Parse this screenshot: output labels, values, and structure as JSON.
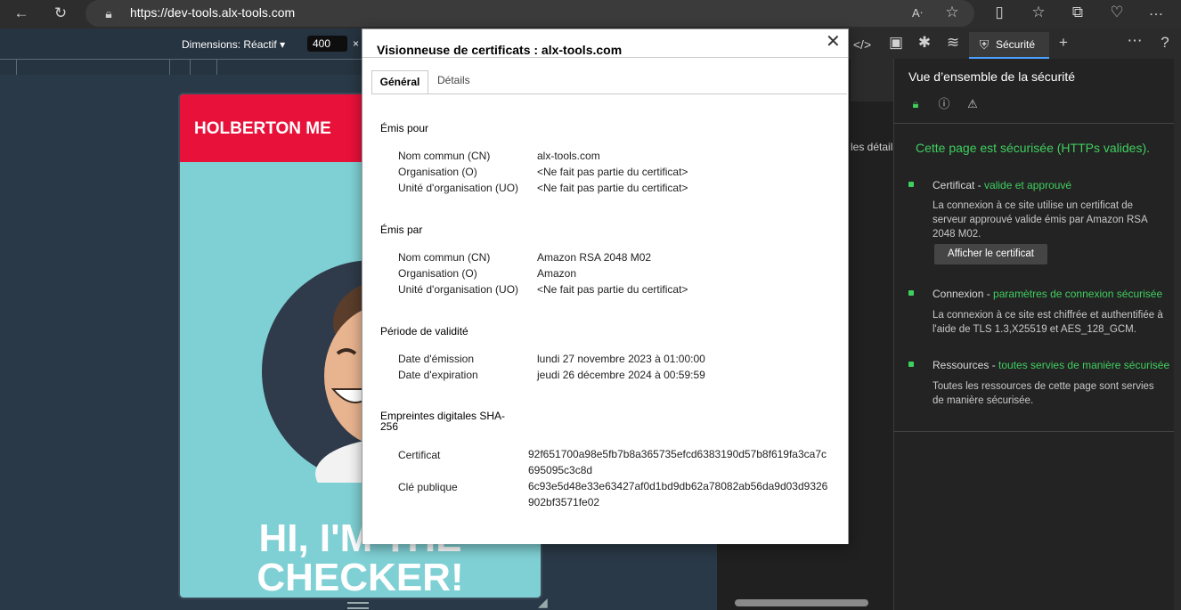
{
  "browser": {
    "url": "https://dev-tools.alx-tools.com"
  },
  "device_toolbar": {
    "dimensions_label": "Dimensions: Réactif",
    "width_value": "400",
    "close_symbol": "×"
  },
  "page": {
    "brand": "HOLBERTON ME",
    "hero_line1": "HI, I'M THE",
    "hero_line2": "CHECKER!"
  },
  "middle_pane": {
    "details_text": "les détails"
  },
  "devtools": {
    "security_tab_label": "Sécurité"
  },
  "security": {
    "title": "Vue d’ensemble de la sécurité",
    "heading": "Cette page est sécurisée (HTTPs valides).",
    "items": [
      {
        "label": "Certificat - ",
        "status": "valide et approuvé",
        "description": "La connexion à ce site utilise un certificat de serveur approuvé valide émis par Amazon RSA 2048 M02."
      },
      {
        "label": "Connexion - ",
        "status": "paramètres de connexion sécurisée",
        "description": "La connexion à ce site est chiffrée et authentifiée à l'aide de TLS 1.3,X25519 et AES_128_GCM."
      },
      {
        "label": "Ressources - ",
        "status": "toutes servies de manière sécurisée",
        "description": "Toutes les ressources de cette page sont servies de manière sécurisée."
      }
    ],
    "view_cert_button": "Afficher le certificat"
  },
  "certificate_viewer": {
    "title": "Visionneuse de certificats : alx-tools.com",
    "tabs": [
      "Général",
      "Détails"
    ],
    "issued_to": {
      "heading": "Émis pour",
      "rows": [
        {
          "key": "Nom commun (CN)",
          "value": "alx-tools.com"
        },
        {
          "key": "Organisation (O)",
          "value": "<Ne fait pas partie du certificat>"
        },
        {
          "key": "Unité d'organisation (UO)",
          "value": "<Ne fait pas partie du certificat>"
        }
      ]
    },
    "issued_by": {
      "heading": "Émis par",
      "rows": [
        {
          "key": "Nom commun (CN)",
          "value": "Amazon RSA 2048 M02"
        },
        {
          "key": "Organisation (O)",
          "value": "Amazon"
        },
        {
          "key": "Unité d'organisation (UO)",
          "value": "<Ne fait pas partie du certificat>"
        }
      ]
    },
    "validity": {
      "heading": "Période de validité",
      "rows": [
        {
          "key": "Date d'émission",
          "value": "lundi 27 novembre 2023 à 01:00:00"
        },
        {
          "key": "Date d'expiration",
          "value": "jeudi 26 décembre 2024 à 00:59:59"
        }
      ]
    },
    "fingerprints": {
      "heading": "Empreintes digitales SHA-256",
      "rows": [
        {
          "key": "Certificat",
          "value": "92f651700a98e5fb7b8a365735efcd6383190d57b8f619fa3ca7c695095c3c8d"
        },
        {
          "key": "Clé publique",
          "value": "6c93e5d48e33e63427af0d1bd9db62a78082ab56da9d03d9326902bf3571fe02"
        }
      ]
    }
  }
}
